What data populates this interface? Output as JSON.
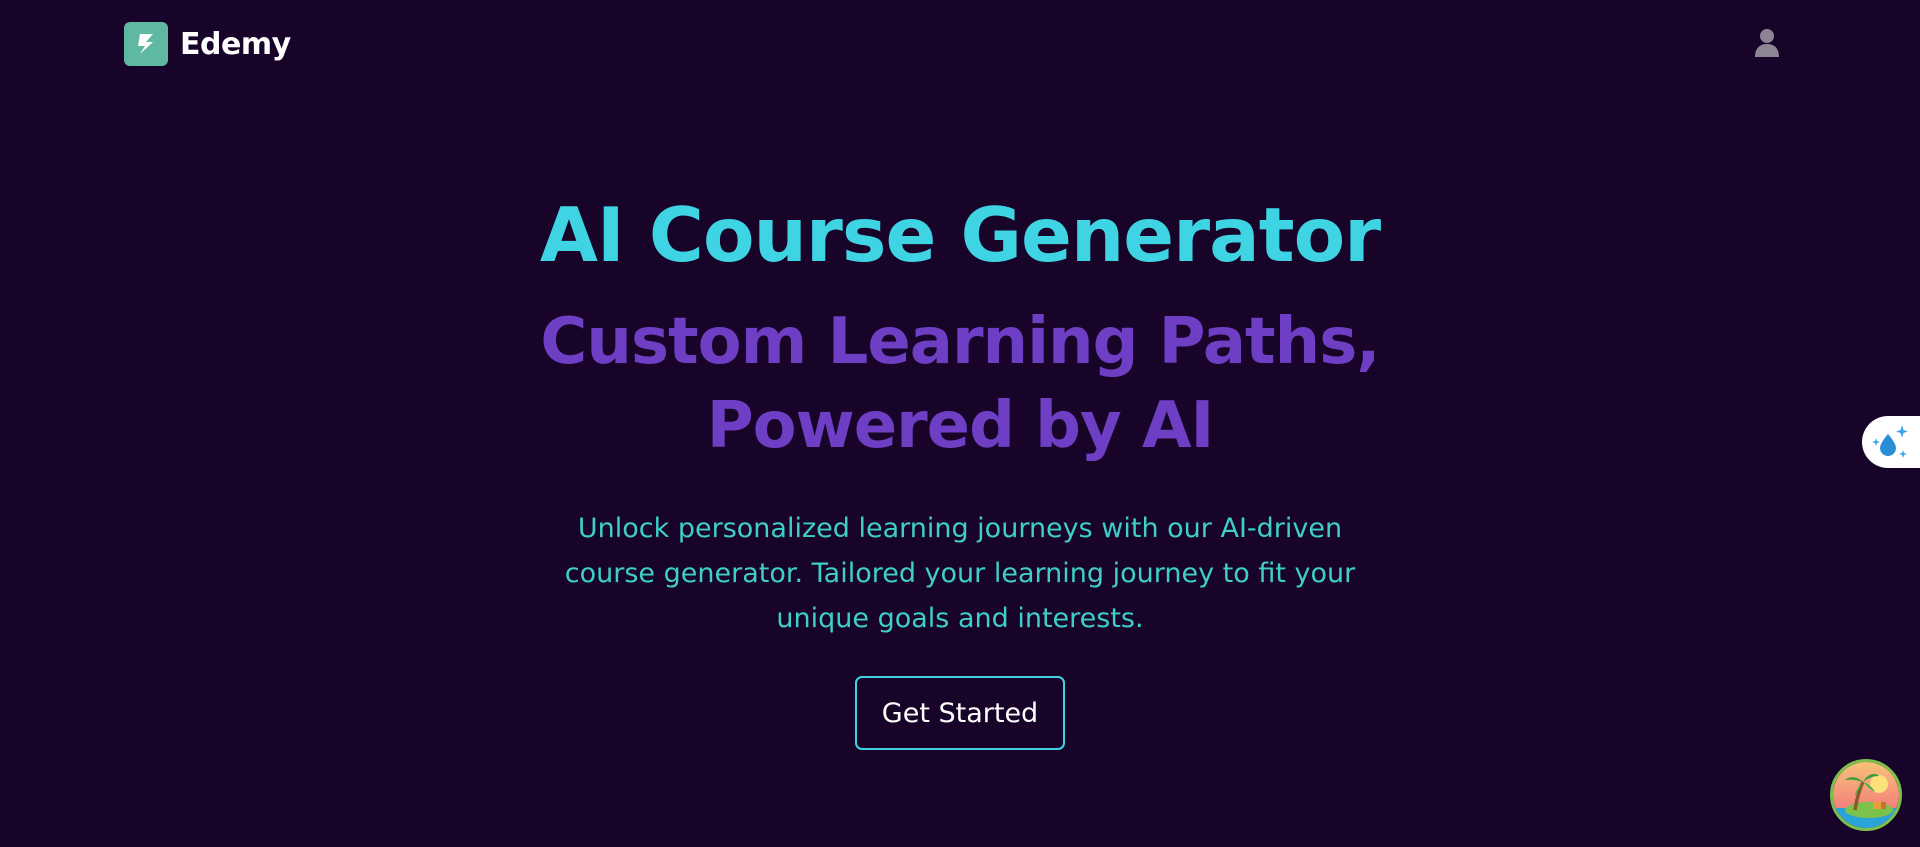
{
  "navbar": {
    "brand_name": "Edemy",
    "logo_icon": "logo-s-icon",
    "user_icon": "user-icon",
    "brand_color": "#5fb9a2"
  },
  "hero": {
    "title": "AI Course Generator",
    "subtitle_line1": "Custom Learning Paths,",
    "subtitle_line2": "Powered by AI",
    "description_line1": "Unlock personalized learning journeys with our AI-driven",
    "description_line2": "course generator. Tailored your learning journey to fit your",
    "description_line3": "unique goals and interests.",
    "cta_label": "Get Started"
  },
  "widgets": {
    "side_tab_icon": "water-drop-sparkle-icon",
    "fab_icon": "island-palm-icon"
  },
  "colors": {
    "background": "#180428",
    "title": "#3fd4e4",
    "subtitle": "#6e3fc4",
    "description": "#3dcfc8",
    "cta_border": "#3fd4e4"
  }
}
